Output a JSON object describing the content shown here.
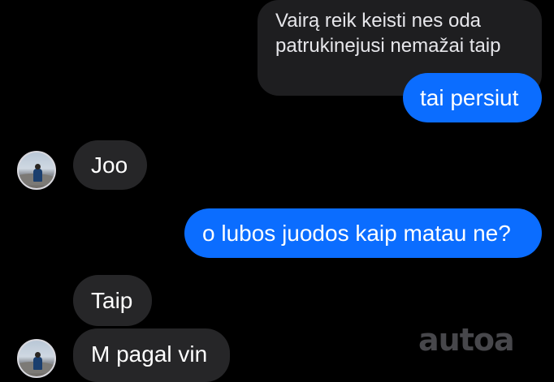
{
  "conversation": {
    "quoted_message": {
      "line1": "Vairą reik keisti nes oda",
      "line2": "patrukinejusi nemažai taip"
    },
    "messages": [
      {
        "text": "tai persiut",
        "sender": "me"
      },
      {
        "text": "Joo",
        "sender": "other"
      },
      {
        "text": "o lubos juodos kaip matau ne?",
        "sender": "me"
      },
      {
        "text": "Taip",
        "sender": "other"
      },
      {
        "text": "M pagal vin",
        "sender": "other"
      }
    ]
  },
  "watermark": "autoa",
  "colors": {
    "background": "#000000",
    "outgoing_bubble": "#0b6dff",
    "incoming_bubble": "#262628",
    "text": "#ffffff"
  },
  "icons": {
    "contact_avatar": "contact-avatar-icon"
  }
}
